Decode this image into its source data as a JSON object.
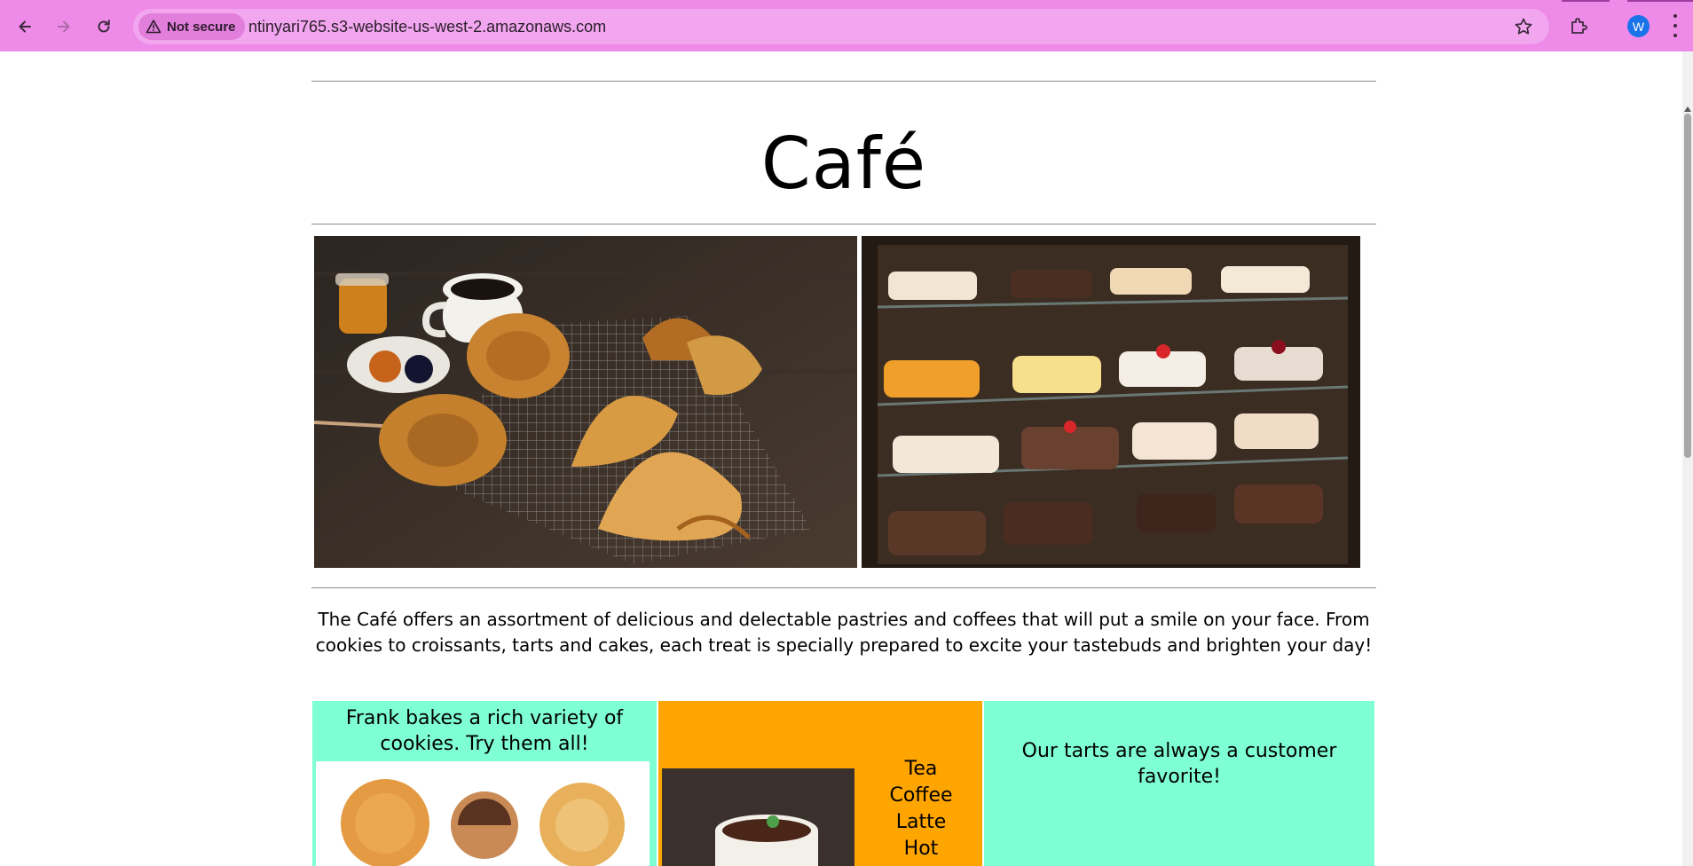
{
  "browser": {
    "security_chip": "Not secure",
    "url": "ntinyari765.s3-website-us-west-2.amazonaws.com",
    "profile_initial": "W",
    "icons": [
      "back-arrow-icon",
      "forward-arrow-icon",
      "reload-icon",
      "warning-icon",
      "bookmark-star-icon",
      "extensions-puzzle-icon",
      "menu-kebab-icon"
    ]
  },
  "page": {
    "title": "Café",
    "intro": "The Café offers an assortment of delicious and delectable pastries and coffees that will put a smile on your face. From cookies to croissants, tarts and cakes, each treat is specially prepared to excite your tastebuds and brighten your day!",
    "cards": {
      "cookies": {
        "text": "Frank bakes a rich variety of cookies. Try them all!"
      },
      "coffee": {
        "drinks": [
          "Tea",
          "Coffee",
          "Latte",
          "Hot"
        ]
      },
      "tarts": {
        "text": "Our tarts are always a customer favorite!"
      }
    }
  },
  "colors": {
    "chrome": "#ee8ae8",
    "omnibox": "#f2a6ef",
    "aquamarine": "#7fffd4",
    "orange": "#ffa500"
  }
}
